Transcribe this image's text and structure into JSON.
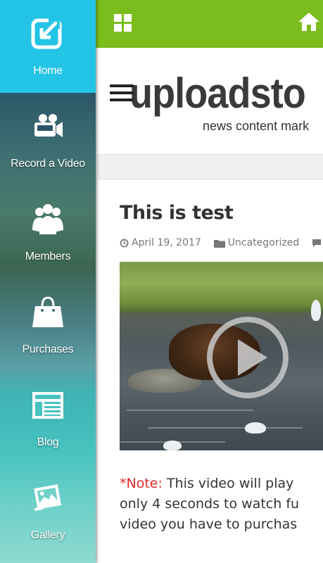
{
  "sidebar": {
    "items": [
      {
        "label": "Home",
        "icon": "home-export-icon",
        "active": true
      },
      {
        "label": "Record a Video",
        "icon": "video-camera-icon",
        "active": false
      },
      {
        "label": "Members",
        "icon": "members-icon",
        "active": false
      },
      {
        "label": "Purchases",
        "icon": "shopping-bag-icon",
        "active": false
      },
      {
        "label": "Blog",
        "icon": "blog-icon",
        "active": false
      },
      {
        "label": "Gallery",
        "icon": "gallery-icon",
        "active": false
      }
    ]
  },
  "topbar": {
    "grid_icon": "grid-icon",
    "home_icon": "home-icon",
    "color": "#7cbd1e"
  },
  "header": {
    "logo": "uploadsto",
    "tagline": "news content mark"
  },
  "post": {
    "title": "This is test",
    "date": "April 19, 2017",
    "category": "Uncategorized",
    "note_label": "*Note:",
    "note_line1": " This video will play",
    "note_line2": "only 4 seconds to watch fu",
    "note_line3": "video you have to purchas"
  },
  "colors": {
    "active_sidebar": "#23c4e6",
    "accent_green": "#7cbd1e",
    "note_red": "#e02b2b"
  }
}
